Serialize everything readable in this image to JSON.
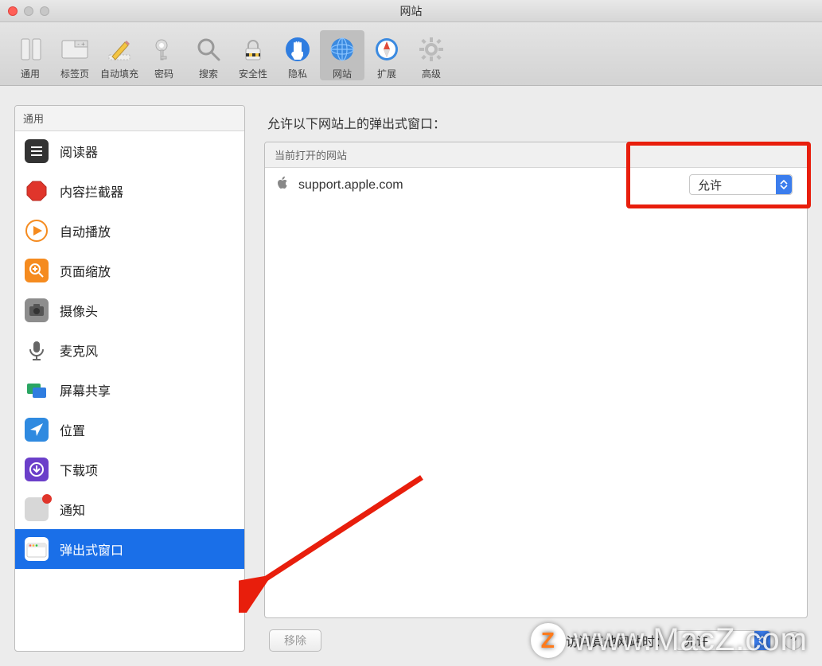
{
  "window": {
    "title": "网站"
  },
  "toolbar": {
    "items": [
      {
        "label": "通用"
      },
      {
        "label": "标签页"
      },
      {
        "label": "自动填充"
      },
      {
        "label": "密码"
      },
      {
        "label": "搜索"
      },
      {
        "label": "安全性"
      },
      {
        "label": "隐私"
      },
      {
        "label": "网站",
        "selected": true
      },
      {
        "label": "扩展"
      },
      {
        "label": "高级"
      }
    ]
  },
  "sidebar": {
    "header": "通用",
    "items": [
      {
        "label": "阅读器"
      },
      {
        "label": "内容拦截器"
      },
      {
        "label": "自动播放"
      },
      {
        "label": "页面缩放"
      },
      {
        "label": "摄像头"
      },
      {
        "label": "麦克风"
      },
      {
        "label": "屏幕共享"
      },
      {
        "label": "位置"
      },
      {
        "label": "下载项"
      },
      {
        "label": "通知"
      },
      {
        "label": "弹出式窗口",
        "selected": true
      }
    ]
  },
  "main": {
    "heading": "允许以下网站上的弹出式窗口：",
    "table_header": "当前打开的网站",
    "rows": [
      {
        "domain": "support.apple.com",
        "value": "允许"
      }
    ],
    "remove_button": "移除",
    "footer_label": "访问其他网站时：",
    "footer_value": "允许"
  },
  "watermark": {
    "badge": "Z",
    "text": "www.MacZ.com"
  }
}
